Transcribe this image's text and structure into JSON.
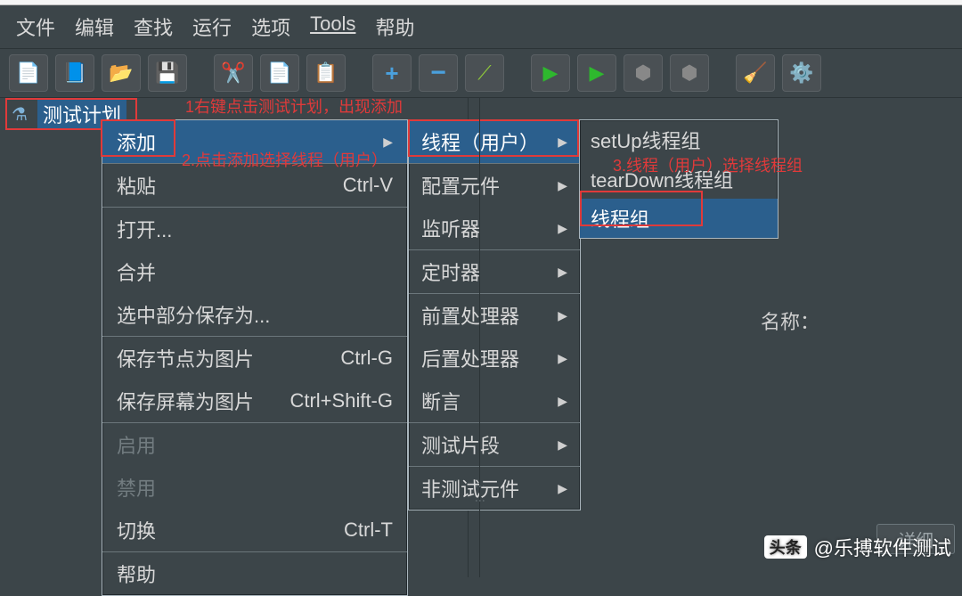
{
  "menubar": {
    "file": "文件",
    "edit": "编辑",
    "find": "查找",
    "run": "运行",
    "options": "选项",
    "tools": "Tools",
    "help": "帮助"
  },
  "toolbar": {
    "new": "new-file-icon",
    "templates": "templates-icon",
    "open": "open-icon",
    "save": "save-icon",
    "cut": "cut-icon",
    "copy": "copy-icon",
    "paste": "paste-icon",
    "expand": "plus-icon",
    "collapse": "minus-icon",
    "wand": "wand-icon",
    "start": "play-icon",
    "start_no_timers": "play-alt-icon",
    "stop": "stop-icon",
    "shutdown": "shutdown-icon",
    "clear": "broom-icon",
    "clear_all": "gear-broom-icon"
  },
  "tree": {
    "root_label": "测试计划"
  },
  "context_menu1": {
    "add": "添加",
    "paste": "粘贴",
    "paste_sc": "Ctrl-V",
    "open": "打开...",
    "merge": "合并",
    "save_selection": "选中部分保存为...",
    "save_node_img": "保存节点为图片",
    "save_node_img_sc": "Ctrl-G",
    "save_screen_img": "保存屏幕为图片",
    "save_screen_img_sc": "Ctrl+Shift-G",
    "enable": "启用",
    "disable": "禁用",
    "toggle": "切换",
    "toggle_sc": "Ctrl-T",
    "help": "帮助"
  },
  "context_menu2": {
    "threads": "线程（用户）",
    "config": "配置元件",
    "listener": "监听器",
    "timer": "定时器",
    "pre": "前置处理器",
    "post": "后置处理器",
    "assert": "断言",
    "fragment": "测试片段",
    "non_test": "非测试元件"
  },
  "context_menu3": {
    "setup": "setUp线程组",
    "teardown": "tearDown线程组",
    "threadgroup": "线程组"
  },
  "annotations": {
    "a1": "1右键点击测试计划，出现添加",
    "a2": "2.点击添加选择线程（用户）",
    "a3": "3.线程（用户）选择线程组"
  },
  "right_panel": {
    "name_label": "名称：",
    "detail_btn": "详细"
  },
  "watermark": {
    "logo": "头条",
    "text": "@乐搏软件测试"
  }
}
